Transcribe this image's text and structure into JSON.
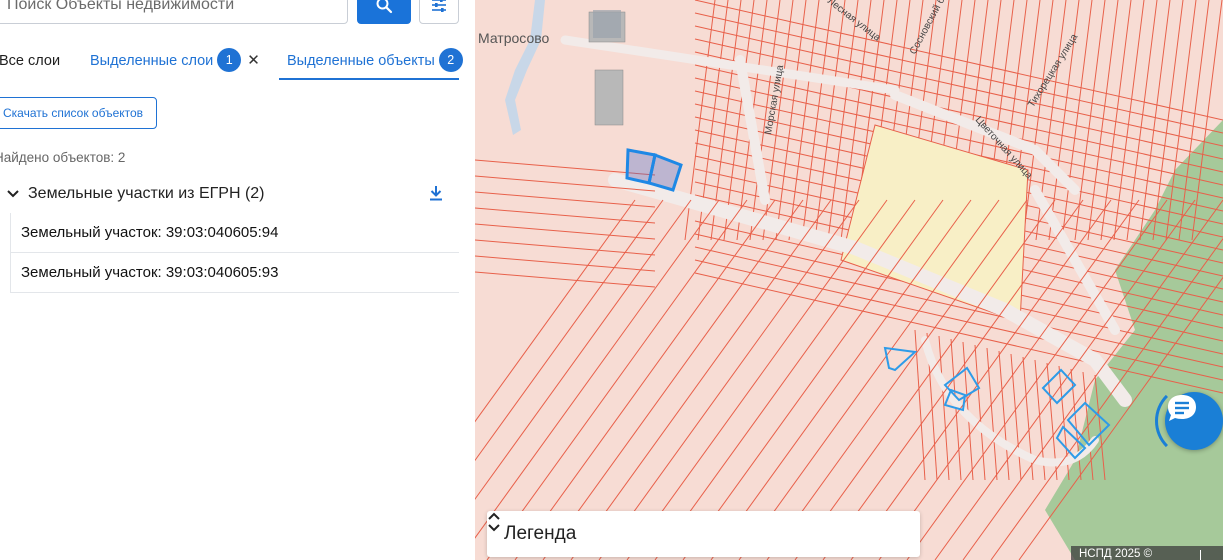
{
  "search": {
    "placeholder": "Поиск Объекты недвижимости",
    "search_icon": "search-icon",
    "filter_icon": "sliders-icon"
  },
  "tabs": [
    {
      "label": "Все слои",
      "active": false
    },
    {
      "label": "Выделенные слои",
      "count": "1",
      "closable": true,
      "active": false
    },
    {
      "label": "Выделенные объекты",
      "count": "2",
      "active": true
    }
  ],
  "download_list_label": "Скачать список объектов",
  "found": "Найдено объектов: 2",
  "group": {
    "title": "Земельные участки из ЕГРН (2)",
    "items": [
      {
        "label": "Земельный участок: 39:03:040605:94"
      },
      {
        "label": "Земельный участок: 39:03:040605:93"
      }
    ]
  },
  "map": {
    "place_label": "Матросово",
    "street_labels": [
      "Морская улица",
      "Цветочная улица",
      "Тихорецкая улица",
      "Сосновский бульвар",
      "Лесная улица"
    ],
    "legend_title": "Легенда",
    "attribution": "НСПД 2025 ©",
    "scale_text": "1",
    "colors": {
      "parcel_line": "#e8604a",
      "parcel_fill": "#f7dcd4",
      "selected": "#1e88e5",
      "highlight_yellow": "#f8efc6",
      "forest": "#a6c99a",
      "accent": "#1f72d4"
    }
  }
}
